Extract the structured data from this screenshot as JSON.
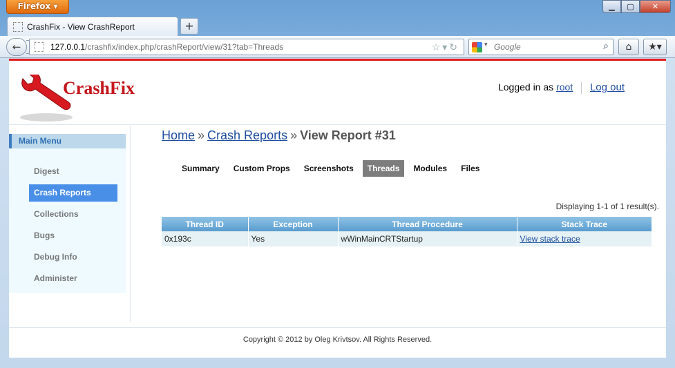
{
  "browser": {
    "menu_label": "Firefox",
    "tab_title": "CrashFix - View CrashReport",
    "url_host": "127.0.0.1",
    "url_path": "/crashfix/index.php/crashReport/view/31?tab=Threads",
    "search_placeholder": "Google"
  },
  "header": {
    "logo_text": "CrashFix",
    "logged_in_prefix": "Logged in as",
    "username": "root",
    "logout_label": "Log out"
  },
  "sidebar": {
    "title": "Main Menu",
    "items": [
      {
        "label": "Digest"
      },
      {
        "label": "Crash Reports"
      },
      {
        "label": "Collections"
      },
      {
        "label": "Bugs"
      },
      {
        "label": "Debug Info"
      },
      {
        "label": "Administer"
      }
    ],
    "active": "Crash Reports"
  },
  "breadcrumb": {
    "home": "Home",
    "crash_reports": "Crash Reports",
    "current": "View Report #31",
    "separator": "»"
  },
  "tabs": [
    "Summary",
    "Custom Props",
    "Screenshots",
    "Threads",
    "Modules",
    "Files"
  ],
  "active_tab": "Threads",
  "grid": {
    "summary": "Displaying 1-1 of 1 result(s).",
    "columns": [
      "Thread ID",
      "Exception",
      "Thread Procedure",
      "Stack Trace"
    ],
    "rows": [
      {
        "thread_id": "0x193c",
        "exception": "Yes",
        "procedure": "wWinMainCRTStartup",
        "stack_trace": "View stack trace"
      }
    ]
  },
  "footer": {
    "copyright": "Copyright © 2012 by Oleg Krivtsov. All Rights Reserved."
  },
  "colors": {
    "accent_red": "#e01c1c",
    "active_menu": "#4a8fe7",
    "link": "#1f4ea0"
  }
}
